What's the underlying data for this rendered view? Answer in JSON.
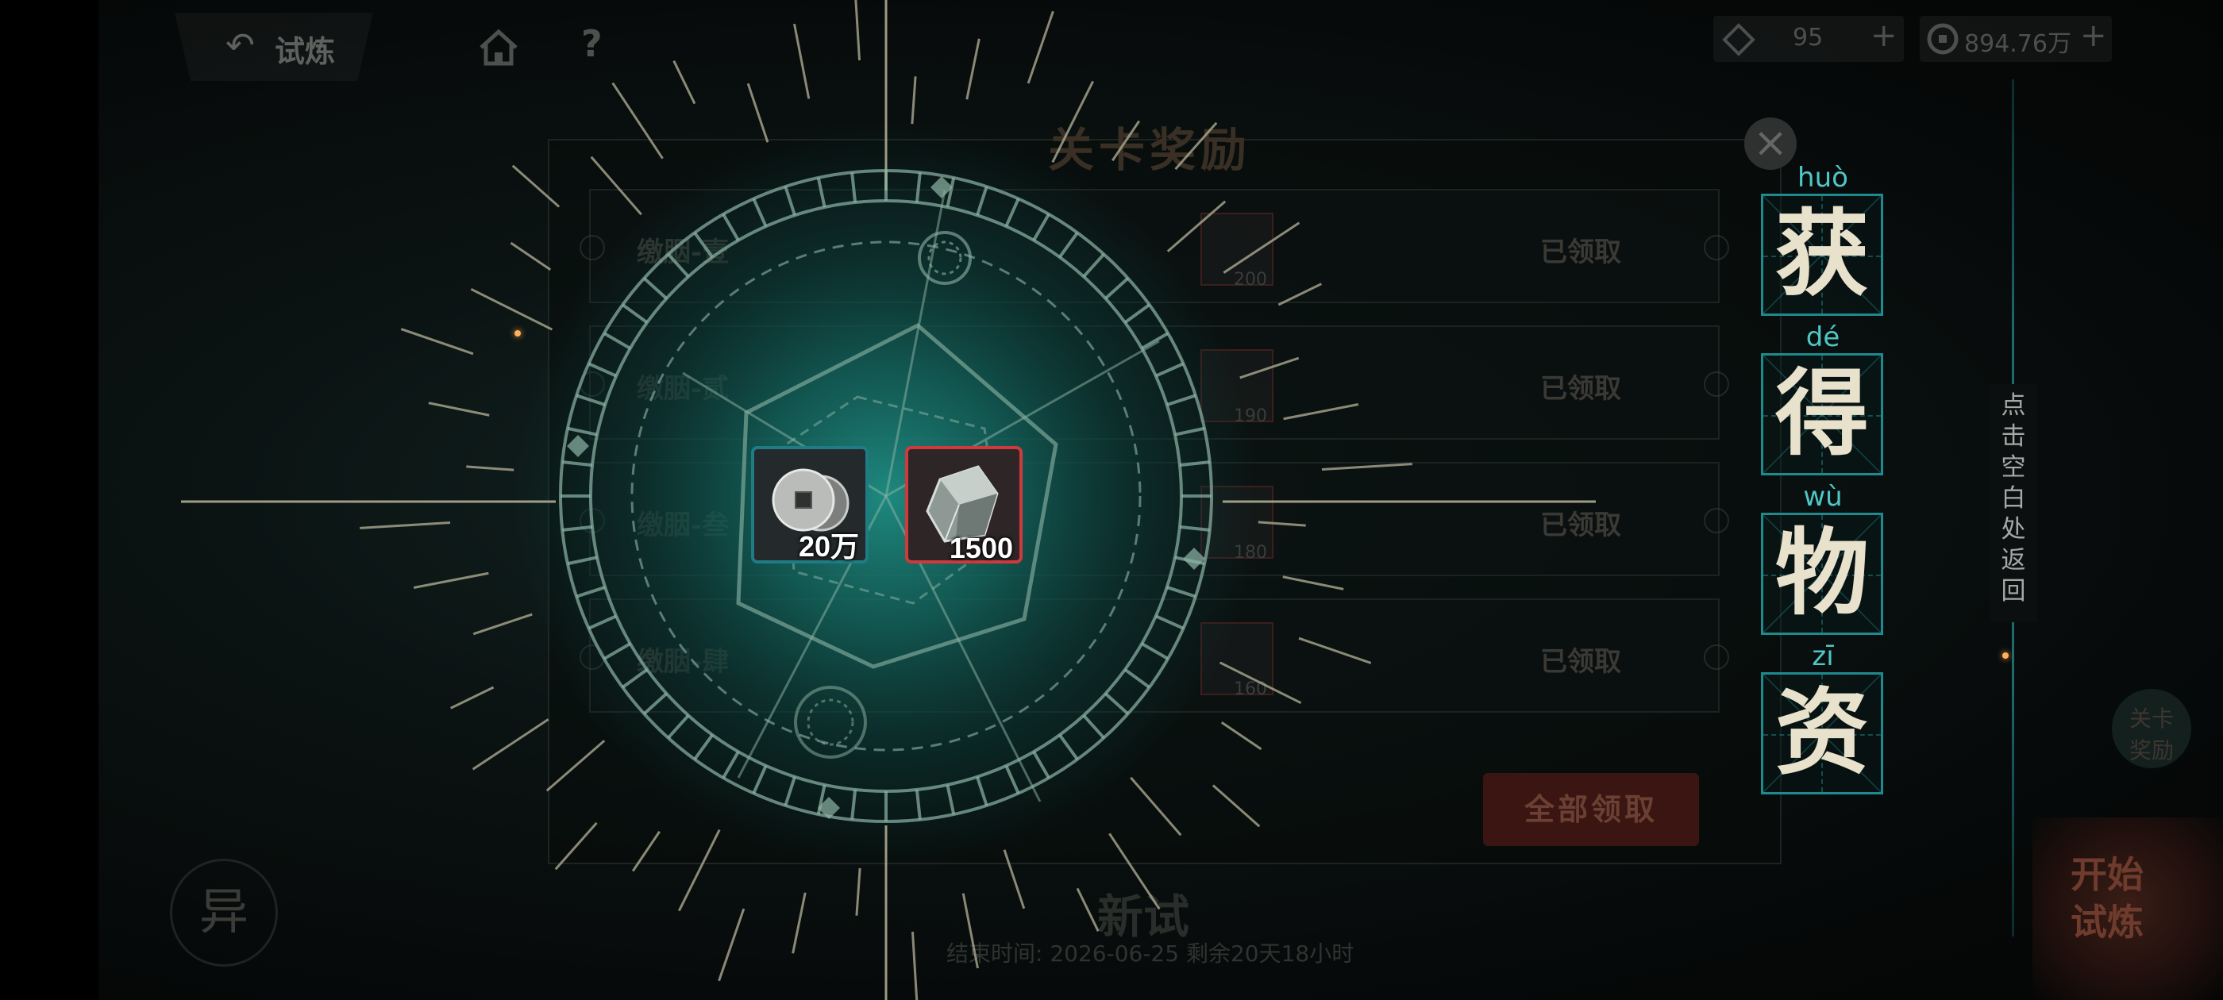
{
  "top_bar": {
    "back_label": "试炼",
    "resource_1": {
      "value": "95",
      "plus": "+"
    },
    "resource_2": {
      "value": "894.76万",
      "plus": "+"
    }
  },
  "reward_panel": {
    "title": "关卡奖励",
    "rows": [
      {
        "name": "缴胭-壹",
        "qty": "200",
        "status": "已领取"
      },
      {
        "name": "缴胭-贰",
        "qty": "190",
        "status": "已领取"
      },
      {
        "name": "缴胭-叁",
        "qty": "180",
        "status": "已领取"
      },
      {
        "name": "缴胭-肆",
        "qty": "160",
        "status": "已领取"
      }
    ],
    "claim_all": "全部领取"
  },
  "event": {
    "title": "新试",
    "end_time": "结束时间: 2026-06-25  剩余20天18小时"
  },
  "left_emblem": "异",
  "side_badge": "关卡\n奖励",
  "start_button": "开始试炼",
  "obtained_items": [
    {
      "icon": "silver-coins-icon",
      "qty": "20万",
      "frame_color": "#1f7c84"
    },
    {
      "icon": "crystal-cube-icon",
      "qty": "1500",
      "frame_color": "#d13a3d"
    }
  ],
  "obtained_title": [
    {
      "pinyin": "huò",
      "char": "获"
    },
    {
      "pinyin": "dé",
      "char": "得"
    },
    {
      "pinyin": "wù",
      "char": "物"
    },
    {
      "pinyin": "zī",
      "char": "资"
    }
  ],
  "hint": "点击空白处返回",
  "colors": {
    "accent_teal": "#1e8a8d",
    "pinyin": "#4fc7c6",
    "rare_red": "#d13a3d"
  }
}
